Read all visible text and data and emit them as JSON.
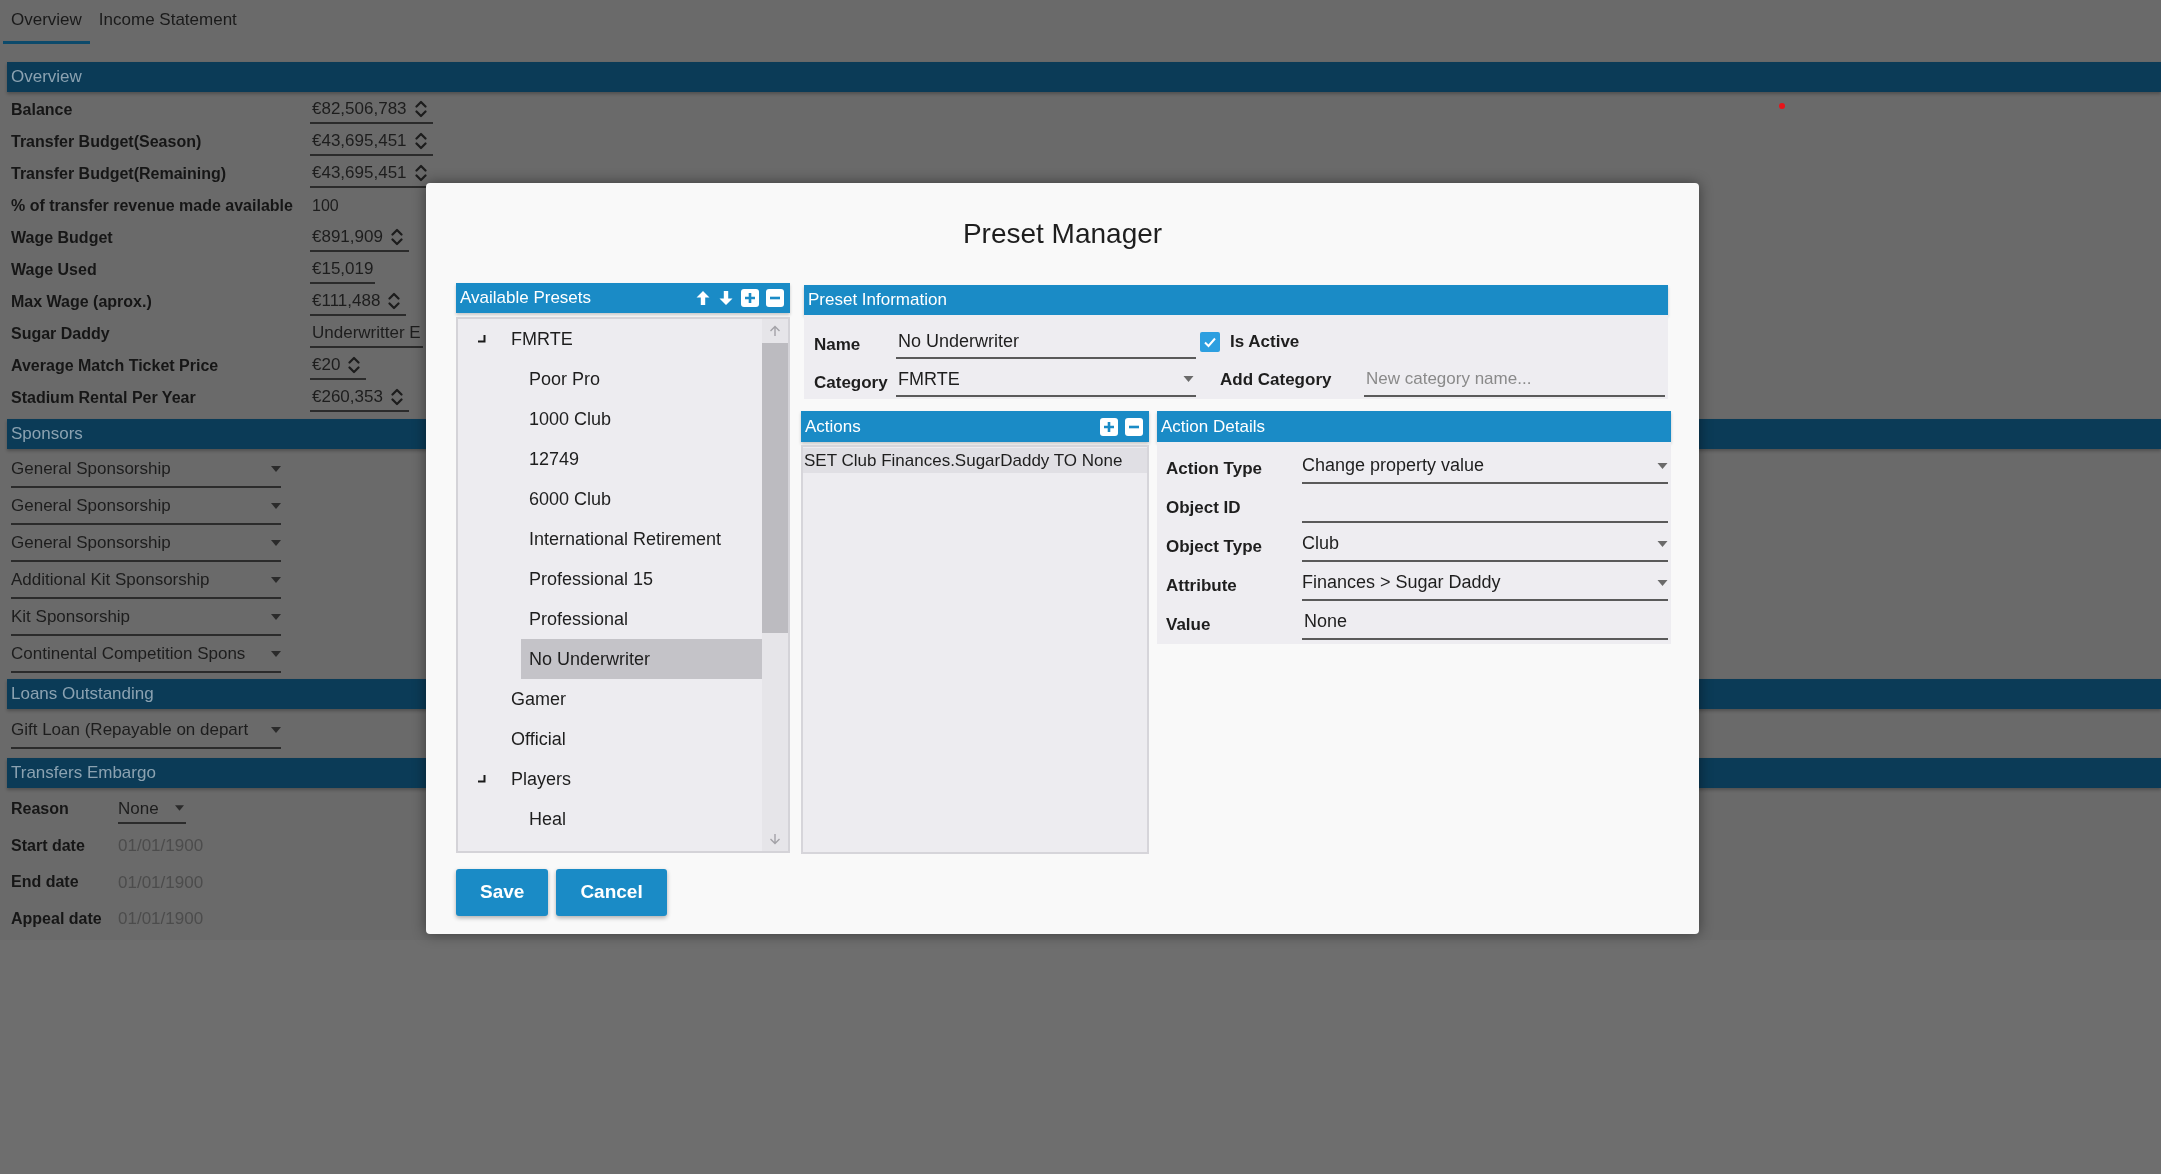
{
  "tabs": [
    {
      "label": "Overview",
      "selected": true
    },
    {
      "label": "Income Statement",
      "selected": false
    }
  ],
  "overview": {
    "title": "Overview",
    "rows": [
      {
        "label": "Balance",
        "value": "€82,506,783",
        "kind": "spin"
      },
      {
        "label": "Transfer Budget(Season)",
        "value": "€43,695,451",
        "kind": "spin"
      },
      {
        "label": "Transfer Budget(Remaining)",
        "value": "€43,695,451",
        "kind": "spin"
      },
      {
        "label": "% of transfer revenue made available",
        "value": "100",
        "kind": "plain"
      },
      {
        "label": "Wage Budget",
        "value": "€891,909",
        "kind": "spin"
      },
      {
        "label": "Wage Used",
        "value": "€15,019",
        "kind": "field"
      },
      {
        "label": "Max Wage (aprox.)",
        "value": "€111,488",
        "kind": "spin"
      },
      {
        "label": "Sugar Daddy",
        "value": "Underwritter E",
        "kind": "field"
      },
      {
        "label": "Average Match Ticket Price",
        "value": "€20",
        "kind": "spin"
      },
      {
        "label": "Stadium Rental Per Year",
        "value": "€260,353",
        "kind": "spin"
      }
    ]
  },
  "sponsors": {
    "title": "Sponsors",
    "items": [
      "General Sponsorship",
      "General Sponsorship",
      "General Sponsorship",
      "Additional Kit Sponsorship",
      "Kit Sponsorship",
      "Continental Competition Spons"
    ]
  },
  "loans": {
    "title": "Loans Outstanding",
    "items": [
      "Gift Loan (Repayable on depart"
    ]
  },
  "transfers_embargo": {
    "title": "Transfers Embargo",
    "rows": [
      {
        "label": "Reason",
        "value": "None",
        "kind": "dropdown"
      },
      {
        "label": "Start date",
        "value": "01/01/1900",
        "kind": "date"
      },
      {
        "label": "End date",
        "value": "01/01/1900",
        "kind": "date"
      },
      {
        "label": "Appeal date",
        "value": "01/01/1900",
        "kind": "date"
      }
    ]
  },
  "dialog": {
    "title": "Preset Manager",
    "available_presets": {
      "title": "Available Presets",
      "tree": [
        {
          "label": "FMRTE",
          "expanded": true,
          "selected": false,
          "children": [
            {
              "label": "Poor Pro",
              "selected": false
            },
            {
              "label": "1000 Club",
              "selected": false
            },
            {
              "label": "12749",
              "selected": false
            },
            {
              "label": "6000 Club",
              "selected": false
            },
            {
              "label": "International Retirement",
              "selected": false
            },
            {
              "label": "Professional 15",
              "selected": false
            },
            {
              "label": "Professional",
              "selected": false
            },
            {
              "label": "No Underwriter",
              "selected": true
            }
          ]
        },
        {
          "label": "Gamer",
          "selected": false
        },
        {
          "label": "Official",
          "selected": false
        },
        {
          "label": "Players",
          "expanded": true,
          "selected": false,
          "children": [
            {
              "label": "Heal",
              "selected": false
            }
          ]
        }
      ]
    },
    "preset_information": {
      "title": "Preset Information",
      "name": {
        "label": "Name",
        "value": "No Underwriter"
      },
      "is_active": {
        "label": "Is Active",
        "checked": true
      },
      "category": {
        "label": "Category",
        "value": "FMRTE"
      },
      "add_category": {
        "label": "Add Category",
        "placeholder": "New category name..."
      }
    },
    "actions": {
      "title": "Actions",
      "items": [
        {
          "text": "SET Club Finances.SugarDaddy TO None",
          "selected": true
        }
      ]
    },
    "action_details": {
      "title": "Action Details",
      "fields": [
        {
          "label": "Action Type",
          "value": "Change property value",
          "kind": "dropdown"
        },
        {
          "label": "Object ID",
          "kind": "text"
        },
        {
          "label": "Object Type",
          "value": "Club",
          "kind": "dropdown"
        },
        {
          "label": "Attribute",
          "value": "Finances > Sugar Daddy",
          "kind": "dropdown"
        },
        {
          "label": "Value",
          "value": "None",
          "kind": "text"
        }
      ]
    },
    "buttons": [
      {
        "label": "Save"
      },
      {
        "label": "Cancel"
      }
    ]
  }
}
